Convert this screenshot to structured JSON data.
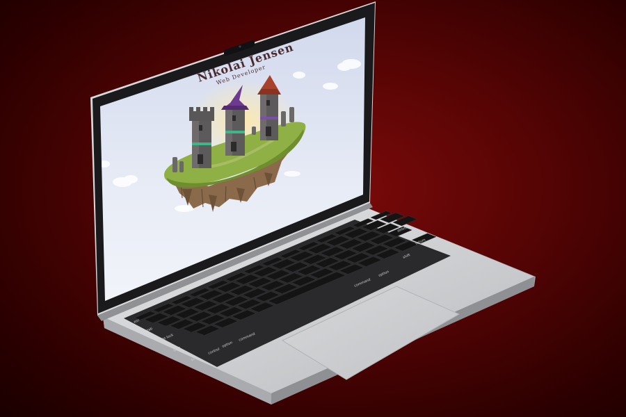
{
  "website": {
    "title": "Nikolai Jensen",
    "subtitle": "Web Developer"
  },
  "keyboard": {
    "labels": [
      "esc",
      "tab",
      "caps lock",
      "shift",
      "fn",
      "control",
      "option",
      "command",
      "command",
      "option",
      "delete",
      "return",
      "shift"
    ]
  },
  "colors": {
    "background": "#560404",
    "sky_top": "#d9dff0",
    "sky_bottom": "#eef1f8",
    "grass": "#8fb044",
    "rock": "#8a6a4a",
    "tower": "#5d5a5b",
    "wizard_hat": "#6c3a8f",
    "red_roof": "#a8422a",
    "laptop_body": "#c9cbcd"
  }
}
